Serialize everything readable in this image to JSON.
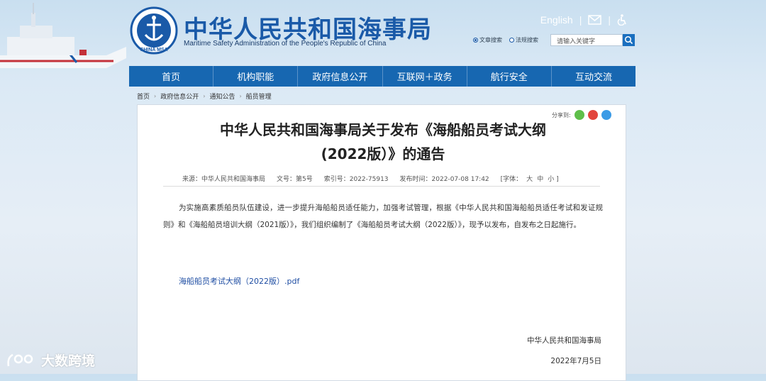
{
  "header": {
    "brand_cn": "中华人民共和国海事局",
    "brand_en": "Maritime Safety Administration of the People's Republic of China",
    "seal_text": "CHINA MSA",
    "english_link": "English",
    "search": {
      "option_1": "文章搜索",
      "option_2": "法规搜索",
      "placeholder": "请输入关键字"
    }
  },
  "nav": {
    "items": [
      "首页",
      "机构职能",
      "政府信息公开",
      "互联网＋政务",
      "航行安全",
      "互动交流"
    ]
  },
  "breadcrumb": [
    "首页",
    "政府信息公开",
    "通知公告",
    "船员管理"
  ],
  "share_label": "分享到:",
  "article": {
    "title_line1": "中华人民共和国海事局关于发布《海船船员考试大纲",
    "title_line2": "(2022版）》的通告",
    "source": "来源：中华人民共和国海事局",
    "doc_no": "文号：第5号",
    "index_no": "索引号：2022-75913",
    "publish_time": "发布时间：2022-07-08 17:42",
    "font_size_label": "[字体：",
    "font_large": "大",
    "font_medium": "中",
    "font_small": "小 ]",
    "body": "为实施高素质船员队伍建设，进一步提升海船船员适任能力，加强考试管理，根据《中华人民共和国海船船员适任考试和发证规则》和《海船船员培训大纲（2021版）》，我们组织编制了《海船船员考试大纲（2022版）》，现予以发布，自发布之日起施行。",
    "attachment": "海船船员考试大纲（2022版）.pdf",
    "signature": "中华人民共和国海事局",
    "date": "2022年7月5日"
  },
  "watermark": "大数跨境",
  "colors": {
    "nav_bg": "#1767b1",
    "brand": "#1a5aa8",
    "link": "#1f4ea3"
  }
}
